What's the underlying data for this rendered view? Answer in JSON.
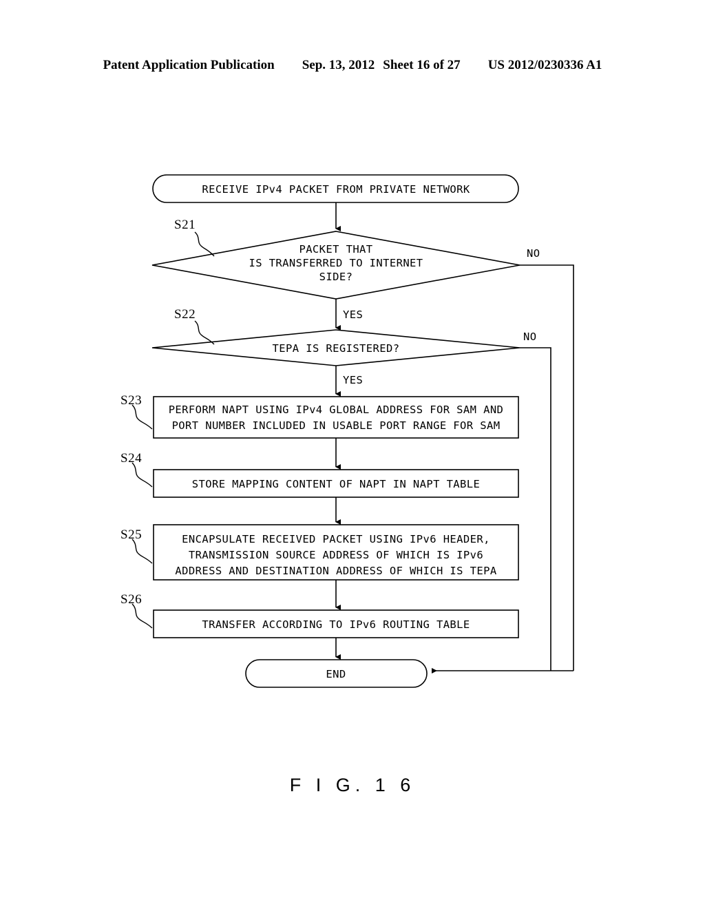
{
  "header": {
    "publication": "Patent Application Publication",
    "date": "Sep. 13, 2012",
    "sheet": "Sheet 16 of 27",
    "patent_number": "US 2012/0230336 A1"
  },
  "figure": {
    "caption": "F I G.  1 6",
    "start_terminal": "RECEIVE IPv4 PACKET FROM PRIVATE NETWORK",
    "end_terminal": "END",
    "decisions": [
      {
        "step": "S21",
        "lines": [
          "PACKET THAT",
          "IS TRANSFERRED TO INTERNET",
          "SIDE?"
        ],
        "yes_label": "YES",
        "no_label": "NO"
      },
      {
        "step": "S22",
        "lines": [
          "TEPA IS REGISTERED?"
        ],
        "yes_label": "YES",
        "no_label": "NO"
      }
    ],
    "processes": [
      {
        "step": "S23",
        "lines": [
          "PERFORM NAPT USING IPv4 GLOBAL ADDRESS FOR SAM AND",
          "PORT NUMBER INCLUDED IN USABLE PORT RANGE FOR SAM"
        ]
      },
      {
        "step": "S24",
        "lines": [
          "STORE MAPPING CONTENT OF NAPT IN NAPT TABLE"
        ]
      },
      {
        "step": "S25",
        "lines": [
          "ENCAPSULATE RECEIVED PACKET USING IPv6 HEADER,",
          "TRANSMISSION SOURCE ADDRESS OF WHICH IS IPv6",
          "ADDRESS AND DESTINATION ADDRESS OF WHICH IS TEPA"
        ]
      },
      {
        "step": "S26",
        "lines": [
          "TRANSFER ACCORDING TO IPv6 ROUTING TABLE"
        ]
      }
    ]
  },
  "colors": {
    "ink": "#000000",
    "page": "#ffffff"
  }
}
